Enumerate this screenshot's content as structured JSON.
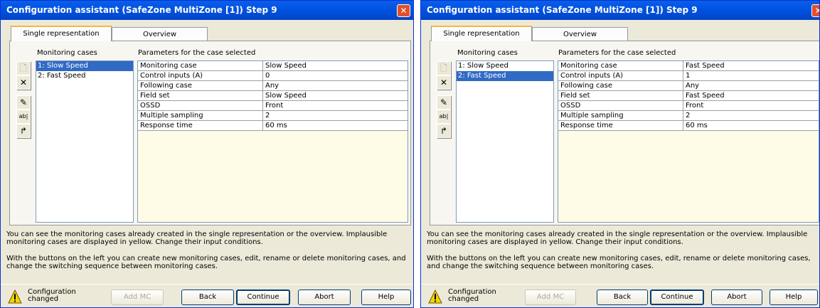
{
  "windows": [
    {
      "title": "Configuration assistant (SafeZone MultiZone [1]) Step 9",
      "tabs": [
        "Single representation",
        "Overview"
      ],
      "monitoring_cases_label": "Monitoring cases",
      "params_label": "Parameters for the case selected",
      "monitoring_cases": [
        "1:  Slow Speed",
        "2:  Fast Speed"
      ],
      "selected_index": 0,
      "params": [
        {
          "k": "Monitoring case",
          "v": "Slow Speed"
        },
        {
          "k": "Control inputs (A)",
          "v": "0"
        },
        {
          "k": "Following case",
          "v": "Any"
        },
        {
          "k": "Field set",
          "v": "Slow Speed"
        },
        {
          "k": "OSSD",
          "v": "Front"
        },
        {
          "k": "Multiple sampling",
          "v": "2"
        },
        {
          "k": "Response time",
          "v": "60 ms"
        }
      ],
      "info1": "You can see the monitoring cases already created in the single representation or the overview. Implausible monitoring cases are displayed in yellow. Change their input conditions.",
      "info2": "With the buttons on the left you can create new monitoring cases, edit, rename or delete monitoring cases, and change the switching sequence between monitoring cases.",
      "status": [
        "Configuration",
        "changed"
      ],
      "buttons": {
        "add_mc": "Add MC",
        "back": "Back",
        "continue": "Continue",
        "abort": "Abort",
        "help": "Help"
      }
    },
    {
      "title": "Configuration assistant (SafeZone MultiZone [1]) Step 9",
      "tabs": [
        "Single representation",
        "Overview"
      ],
      "monitoring_cases_label": "Monitoring cases",
      "params_label": "Parameters for the case selected",
      "monitoring_cases": [
        "1:  Slow Speed",
        "2:  Fast Speed"
      ],
      "selected_index": 1,
      "params": [
        {
          "k": "Monitoring case",
          "v": "Fast Speed"
        },
        {
          "k": "Control inputs (A)",
          "v": "1"
        },
        {
          "k": "Following case",
          "v": "Any"
        },
        {
          "k": "Field set",
          "v": "Fast Speed"
        },
        {
          "k": "OSSD",
          "v": "Front"
        },
        {
          "k": "Multiple sampling",
          "v": "2"
        },
        {
          "k": "Response time",
          "v": "60 ms"
        }
      ],
      "info1": "You can see the monitoring cases already created in the single representation or the overview. Implausible monitoring cases are displayed in yellow. Change their input conditions.",
      "info2": "With the buttons on the left you can create new monitoring cases, edit, rename or delete monitoring cases, and change the switching sequence between monitoring cases.",
      "status": [
        "Configuration",
        "changed"
      ],
      "buttons": {
        "add_mc": "Add MC",
        "back": "Back",
        "continue": "Continue",
        "abort": "Abort",
        "help": "Help"
      }
    }
  ],
  "colors": {
    "titlebar": "#0054e3",
    "selection": "#316ac5",
    "params_bg": "#fefce7",
    "dialog_bg": "#ece9d8"
  },
  "icons": {
    "close": "close-icon",
    "new": "new-mc-icon",
    "delete": "delete-icon",
    "edit": "edit-icon",
    "rename": "rename-icon",
    "sequence": "sequence-icon",
    "warning": "warning-icon"
  }
}
